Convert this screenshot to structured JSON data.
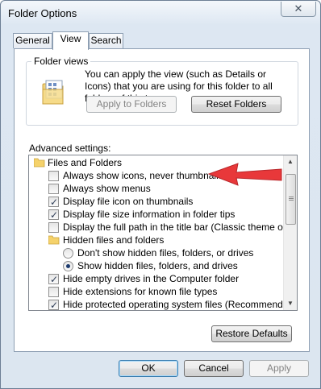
{
  "window": {
    "title": "Folder Options",
    "close_glyph": "✕"
  },
  "tabs": [
    {
      "label": "General",
      "active": false
    },
    {
      "label": "View",
      "active": true
    },
    {
      "label": "Search",
      "active": false
    }
  ],
  "folder_views": {
    "group_label": "Folder views",
    "description": "You can apply the view (such as Details or Icons) that you are using for this folder to all folders of this type.",
    "apply_button": "Apply to Folders",
    "reset_button": "Reset Folders"
  },
  "advanced": {
    "label": "Advanced settings:",
    "items": [
      {
        "text": "Files and Folders",
        "kind": "folder",
        "level": 0
      },
      {
        "text": "Always show icons, never thumbnails",
        "kind": "checkbox",
        "checked": false,
        "level": 1
      },
      {
        "text": "Always show menus",
        "kind": "checkbox",
        "checked": false,
        "level": 1
      },
      {
        "text": "Display file icon on thumbnails",
        "kind": "checkbox",
        "checked": true,
        "level": 1
      },
      {
        "text": "Display file size information in folder tips",
        "kind": "checkbox",
        "checked": true,
        "level": 1
      },
      {
        "text": "Display the full path in the title bar (Classic theme only)",
        "kind": "checkbox",
        "checked": false,
        "level": 1
      },
      {
        "text": "Hidden files and folders",
        "kind": "folder",
        "level": 1
      },
      {
        "text": "Don't show hidden files, folders, or drives",
        "kind": "radio",
        "checked": false,
        "level": 2
      },
      {
        "text": "Show hidden files, folders, and drives",
        "kind": "radio",
        "checked": true,
        "level": 2
      },
      {
        "text": "Hide empty drives in the Computer folder",
        "kind": "checkbox",
        "checked": true,
        "level": 1
      },
      {
        "text": "Hide extensions for known file types",
        "kind": "checkbox",
        "checked": false,
        "level": 1
      },
      {
        "text": "Hide protected operating system files (Recommended)",
        "kind": "checkbox",
        "checked": true,
        "level": 1
      }
    ],
    "restore_button": "Restore Defaults"
  },
  "footer": {
    "ok": "OK",
    "cancel": "Cancel",
    "apply": "Apply"
  },
  "colors": {
    "annotation_arrow": "#e8383a",
    "folder_icon": "#f5d26b"
  },
  "icons": {
    "folder": "folder-icon",
    "folder_views": "folder-views-icon",
    "scroll_up": "scroll-up-icon",
    "scroll_down": "scroll-down-icon"
  }
}
